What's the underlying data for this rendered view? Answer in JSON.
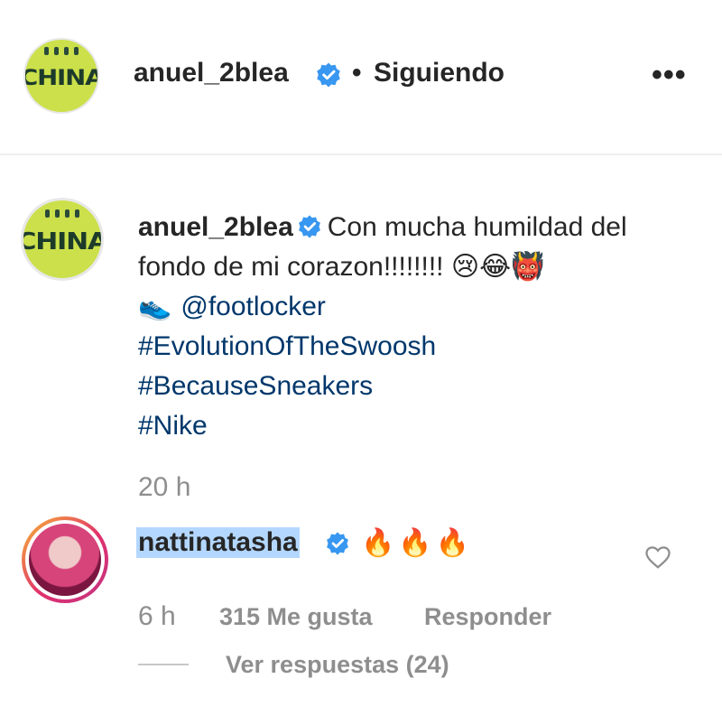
{
  "header": {
    "username": "anuel_2blea",
    "separator": "•",
    "follow_status": "Siguiendo",
    "more_label": "•••",
    "avatar_logo": "CHINA"
  },
  "caption": {
    "username": "anuel_2blea",
    "text_line1": "Con mucha humildad del fondo de mi corazon!!!!!!!!",
    "emojis": "😢😂👹",
    "shoe_emoji": "👟",
    "mention": "@footlocker",
    "hashtags": [
      "#EvolutionOfTheSwoosh",
      "#BecauseSneakers",
      "#Nike"
    ],
    "time": "20 h"
  },
  "comment": {
    "username": "nattinatasha",
    "text": "🔥🔥🔥",
    "time": "6 h",
    "likes": "315 Me gusta",
    "reply_label": "Responder",
    "view_replies": "Ver respuestas (24)"
  },
  "colors": {
    "verified": "#3897f0",
    "link": "#00376b",
    "meta": "#8e8e8e",
    "selection": "#b3d7ff"
  }
}
